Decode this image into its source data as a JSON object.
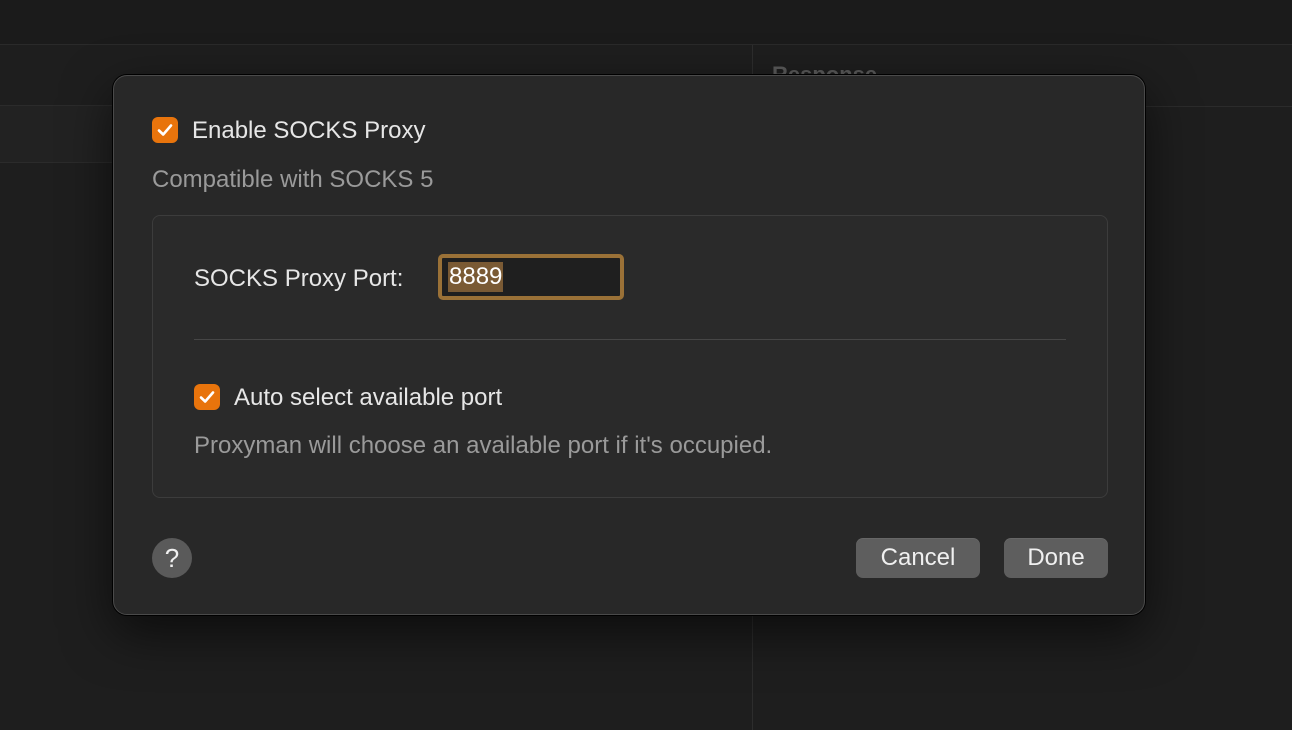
{
  "background": {
    "right_panel_title": "Response"
  },
  "dialog": {
    "enable_checkbox": {
      "label": "Enable SOCKS Proxy",
      "checked": true
    },
    "subtitle": "Compatible with SOCKS 5",
    "port": {
      "label": "SOCKS Proxy Port:",
      "value": "8889"
    },
    "auto_select_checkbox": {
      "label": "Auto select available port",
      "checked": true
    },
    "auto_select_description": "Proxyman will choose an available port if it's occupied.",
    "help_label": "?",
    "cancel_label": "Cancel",
    "done_label": "Done"
  },
  "colors": {
    "accent": "#e8740c",
    "focus_ring": "#9a7137",
    "selection": "#7a5a34"
  }
}
